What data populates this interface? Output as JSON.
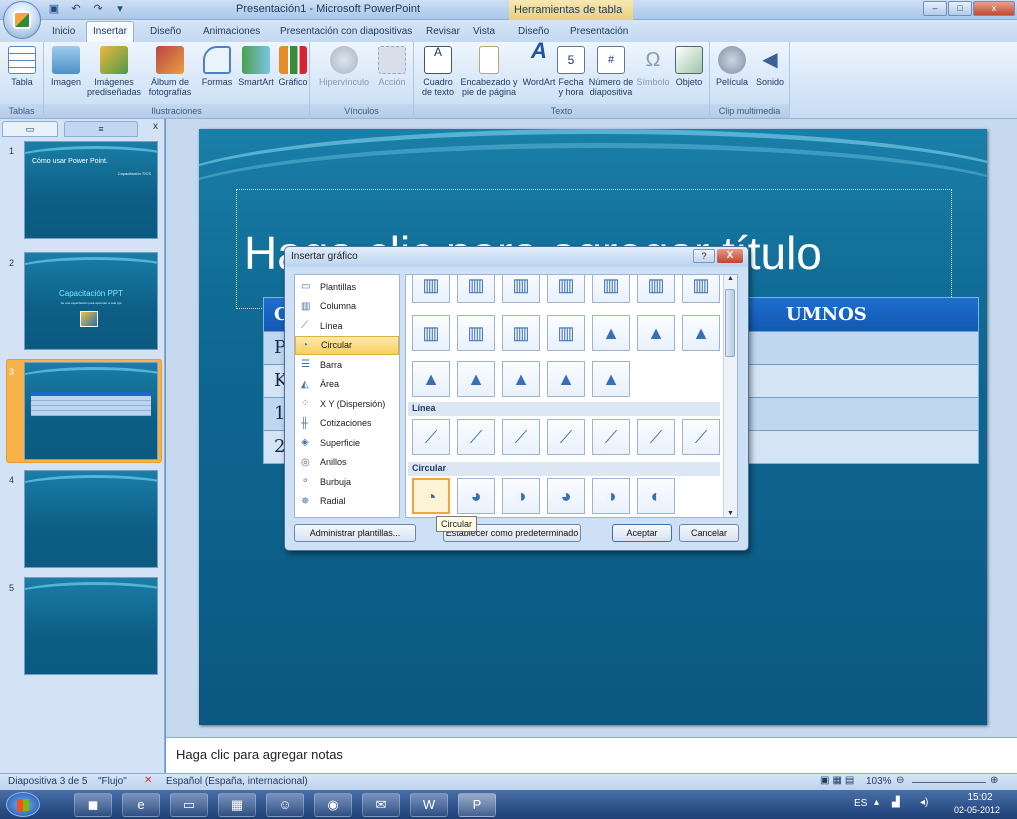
{
  "titlebar": {
    "title": "Presentación1 - Microsoft PowerPoint",
    "contextual_title": "Herramientas de tabla",
    "controls": {
      "minimize": "–",
      "restore": "□",
      "close": "x"
    }
  },
  "tabs": [
    "Inicio",
    "Insertar",
    "Diseño",
    "Animaciones",
    "Presentación con diapositivas",
    "Revisar",
    "Vista",
    "Diseño",
    "Presentación"
  ],
  "ribbon": {
    "tablas": {
      "label": "Tablas",
      "tabla": "Tabla"
    },
    "ilustraciones": {
      "label": "Ilustraciones",
      "imagen": "Imagen",
      "imagenes_pre": "Imágenes\nprediseñadas",
      "album": "Álbum de\nfotografías",
      "formas": "Formas",
      "smartart": "SmartArt",
      "grafico": "Gráfico"
    },
    "vinculos": {
      "label": "Vínculos",
      "hipervinculo": "Hipervínculo",
      "accion": "Acción"
    },
    "texto": {
      "label": "Texto",
      "cuadro": "Cuadro\nde texto",
      "encabezado": "Encabezado y\npie de página",
      "wordart": "WordArt",
      "fecha": "Fecha\ny hora",
      "numero": "Número de\ndiapositiva",
      "simbolo": "Símbolo",
      "objeto": "Objeto"
    },
    "clip": {
      "label": "Clip multimedia",
      "pelicula": "Película",
      "sonido": "Sonido"
    }
  },
  "slides_panel": {
    "slides": [
      {
        "num": "1",
        "title": "Cómo usar Power Point.",
        "subtitle": "Capacitación TICS"
      },
      {
        "num": "2",
        "title": "Capacitación PPT",
        "subtitle": "Se una capacitación para aprender a usar ppt"
      },
      {
        "num": "3"
      },
      {
        "num": "4"
      },
      {
        "num": "5"
      }
    ]
  },
  "slide": {
    "title_text": "Haga clic para agregar título",
    "table": {
      "header_left": "Curs",
      "header_right": "UMNOS",
      "rows": [
        "PK",
        "KINI",
        "1º A",
        "2º A"
      ]
    }
  },
  "dialog": {
    "title": "Insertar gráfico",
    "help": "?",
    "close": "X",
    "categories": [
      {
        "label": "Plantillas",
        "icon": "folder-icon"
      },
      {
        "label": "Columna",
        "icon": "column-chart-icon"
      },
      {
        "label": "Línea",
        "icon": "line-chart-icon"
      },
      {
        "label": "Circular",
        "icon": "pie-chart-icon"
      },
      {
        "label": "Barra",
        "icon": "bar-chart-icon"
      },
      {
        "label": "Área",
        "icon": "area-chart-icon"
      },
      {
        "label": "X Y (Dispersión)",
        "icon": "scatter-chart-icon"
      },
      {
        "label": "Cotizaciones",
        "icon": "stock-chart-icon"
      },
      {
        "label": "Superficie",
        "icon": "surface-chart-icon"
      },
      {
        "label": "Anillos",
        "icon": "doughnut-chart-icon"
      },
      {
        "label": "Burbuja",
        "icon": "bubble-chart-icon"
      },
      {
        "label": "Radial",
        "icon": "radar-chart-icon"
      }
    ],
    "selected_category": "Circular",
    "sections": {
      "linea": "Línea",
      "circular": "Circular"
    },
    "buttons": {
      "manage": "Administrar plantillas...",
      "set_default": "Establecer como predeterminado",
      "ok": "Aceptar",
      "cancel": "Cancelar"
    },
    "tooltip": "Circular"
  },
  "notes": {
    "placeholder": "Haga clic para agregar notas"
  },
  "statusbar": {
    "slide_info": "Diapositiva 3 de 5",
    "theme": "\"Flujo\"",
    "language": "Español (España, internacional)",
    "zoom": "103%"
  },
  "taskbar": {
    "lang": "ES",
    "time": "15:02",
    "date": "02-05-2012"
  }
}
